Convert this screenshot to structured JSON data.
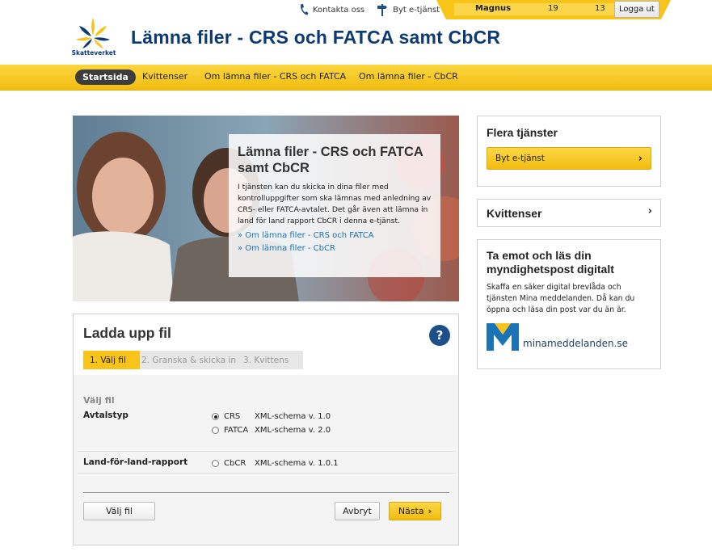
{
  "topbar": {
    "contact_label": "Kontakta oss",
    "switch_service_label": "Byt e-tjänst",
    "user_name": "Magnus",
    "user_field_1": "19",
    "user_field_2": "13",
    "logout_label": "Logga ut"
  },
  "header": {
    "logo_text": "Skatteverket",
    "title": "Lämna filer - CRS och FATCA samt CbCR"
  },
  "nav": {
    "items": [
      {
        "label": "Startsida",
        "active": true
      },
      {
        "label": "Kvittenser"
      },
      {
        "label": "Om lämna filer - CRS och FATCA"
      },
      {
        "label": "Om lämna filer - CbCR"
      }
    ]
  },
  "hero": {
    "title": "Lämna filer - CRS och FATCA samt CbCR",
    "text": "I tjänsten kan du skicka in dina filer med kontrolluppgifter som ska lämnas med anledning av CRS- eller FATCA-avtalet. Det går även att lämna in land för land rapport CbCR i denna e-tjänst.",
    "links": [
      "» Om lämna filer - CRS och FATCA",
      "» Om lämna filer - CbCR"
    ]
  },
  "upload": {
    "title": "Ladda upp fil",
    "help_label": "?",
    "steps": [
      "1. Välj fil",
      "2. Granska & skicka in",
      "3. Kvittens"
    ],
    "section_label": "Välj fil",
    "agreement_label": "Avtalstyp",
    "options": [
      {
        "label": "CRS",
        "schema": "XML-schema v. 1.0",
        "selected": true
      },
      {
        "label": "FATCA",
        "schema": "XML-schema v. 2.0",
        "selected": false
      }
    ],
    "cbcr_label": "Land-för-land-rapport",
    "cbcr_option": {
      "label": "CbCR",
      "schema": "XML-schema v. 1.0.1",
      "selected": false
    },
    "choose_file_label": "Välj fil",
    "cancel_label": "Avbryt",
    "next_label": "Nästa"
  },
  "sidebar": {
    "more_services_title": "Flera tjänster",
    "switch_service_button": "Byt e-tjänst",
    "receipts_title": "Kvittenser",
    "digital_mail_title": "Ta emot och läs din myndighetspost digitalt",
    "digital_mail_text": "Skaffa en säker digital brevlåda och tjänsten Mina meddelanden. Då kan du öppna och läsa din post var du än är.",
    "mina_logo_text": "minameddelanden.se"
  },
  "colors": {
    "brand_blue": "#0d3a73",
    "accent_yellow": "#f8c41a",
    "link_blue": "#1a73b5"
  }
}
